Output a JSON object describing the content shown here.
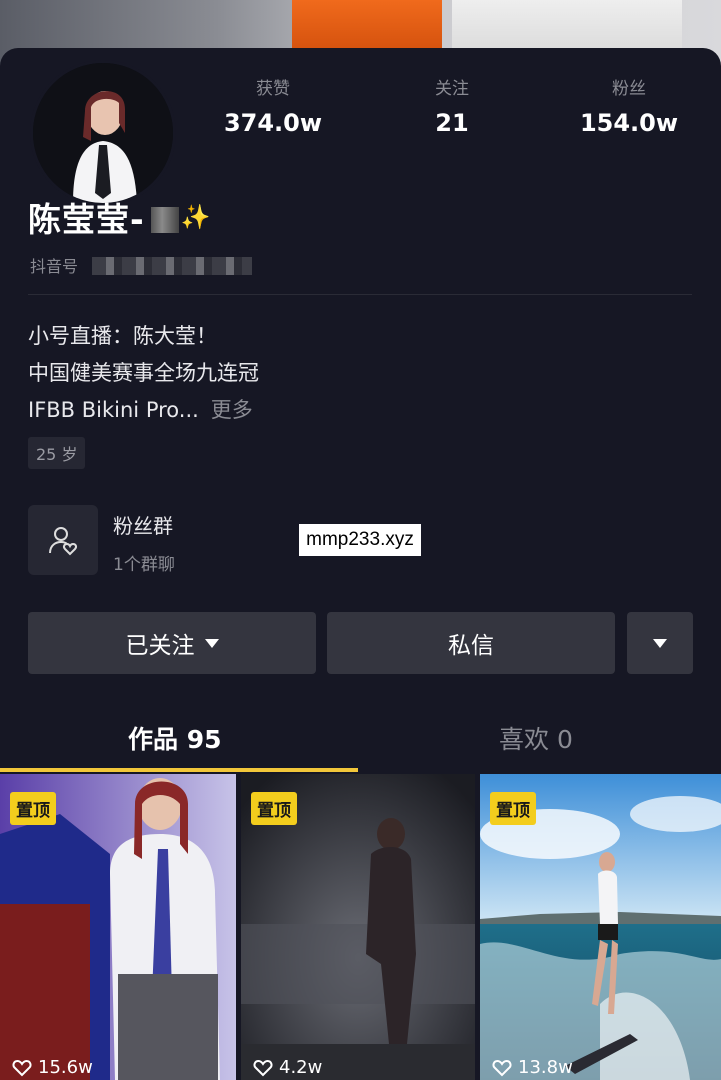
{
  "stats": {
    "likes_label": "获赞",
    "likes_value": "374.0w",
    "following_label": "关注",
    "following_value": "21",
    "fans_label": "粉丝",
    "fans_value": "154.0w"
  },
  "profile": {
    "name": "陈莹莹-",
    "id_label": "抖音号",
    "bio_line1": "小号直播：陈大莹！",
    "bio_line2": "中国健美赛事全场九连冠",
    "bio_line3": "IFBB Bikini Pro...",
    "more": "更多",
    "age": "25 岁"
  },
  "fan_group": {
    "title": "粉丝群",
    "subtitle": "1个群聊"
  },
  "watermark": "mmp233.xyz",
  "actions": {
    "follow": "已关注",
    "message": "私信"
  },
  "tabs": {
    "works": "作品 95",
    "liked": "喜欢 0"
  },
  "videos": [
    {
      "pin": "置顶",
      "likes": "15.6w"
    },
    {
      "pin": "置顶",
      "likes": "4.2w"
    },
    {
      "pin": "置顶",
      "likes": "13.8w"
    }
  ],
  "colors": {
    "background": "#161724",
    "accent": "#f2c73a",
    "button": "#34353f"
  }
}
